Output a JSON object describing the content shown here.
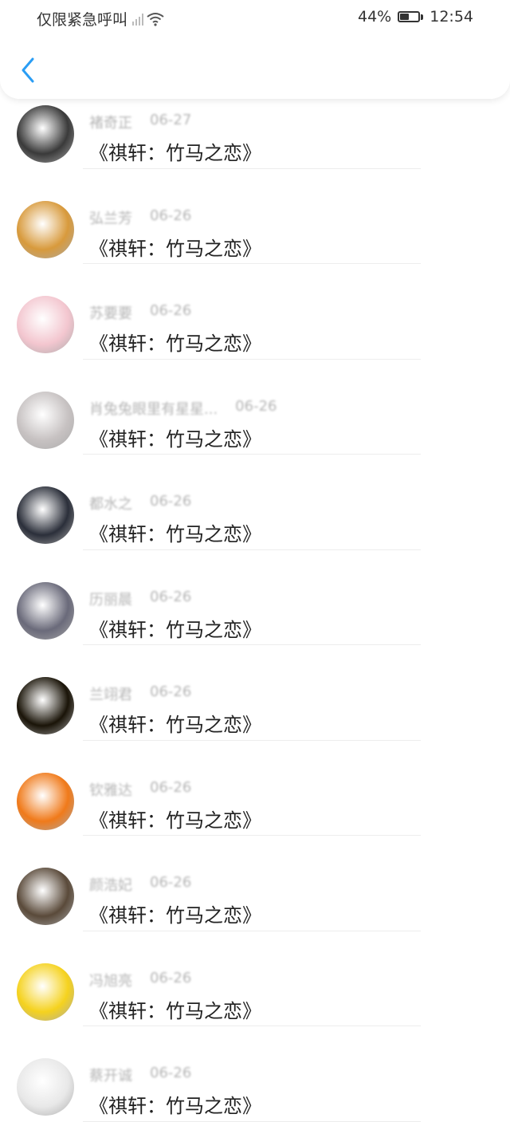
{
  "status_bar": {
    "carrier": "仅限紧急呼叫",
    "battery": "44%",
    "time": "12:54"
  },
  "header": {
    "back_icon": "chevron-left-icon",
    "accent": "#2a9df4"
  },
  "list": [
    {
      "name": "褚奇正",
      "date": "06-27",
      "message": "《祺轩：竹马之恋》",
      "avatar_color": "#3a3a3a"
    },
    {
      "name": "弘兰芳",
      "date": "06-26",
      "message": "《祺轩：竹马之恋》",
      "avatar_color": "#d89a3c"
    },
    {
      "name": "苏要要",
      "date": "06-26",
      "message": "《祺轩：竹马之恋》",
      "avatar_color": "#f3c6cf"
    },
    {
      "name": "肖兔兔眼里有星星...",
      "date": "06-26",
      "message": "《祺轩：竹马之恋》",
      "avatar_color": "#c7c2c2"
    },
    {
      "name": "都水之",
      "date": "06-26",
      "message": "《祺轩：竹马之恋》",
      "avatar_color": "#2b2f3a"
    },
    {
      "name": "历丽晨",
      "date": "06-26",
      "message": "《祺轩：竹马之恋》",
      "avatar_color": "#6a6a7a"
    },
    {
      "name": "兰翊君",
      "date": "06-26",
      "message": "《祺轩：竹马之恋》",
      "avatar_color": "#1a1408"
    },
    {
      "name": "钦雅达",
      "date": "06-26",
      "message": "《祺轩：竹马之恋》",
      "avatar_color": "#f07a1a"
    },
    {
      "name": "颜浩妃",
      "date": "06-26",
      "message": "《祺轩：竹马之恋》",
      "avatar_color": "#5a4a3a"
    },
    {
      "name": "冯旭亮",
      "date": "06-26",
      "message": "《祺轩：竹马之恋》",
      "avatar_color": "#f5d21e"
    },
    {
      "name": "蔡开诚",
      "date": "06-26",
      "message": "《祺轩：竹马之恋》",
      "avatar_color": "#e8e8e8"
    }
  ]
}
